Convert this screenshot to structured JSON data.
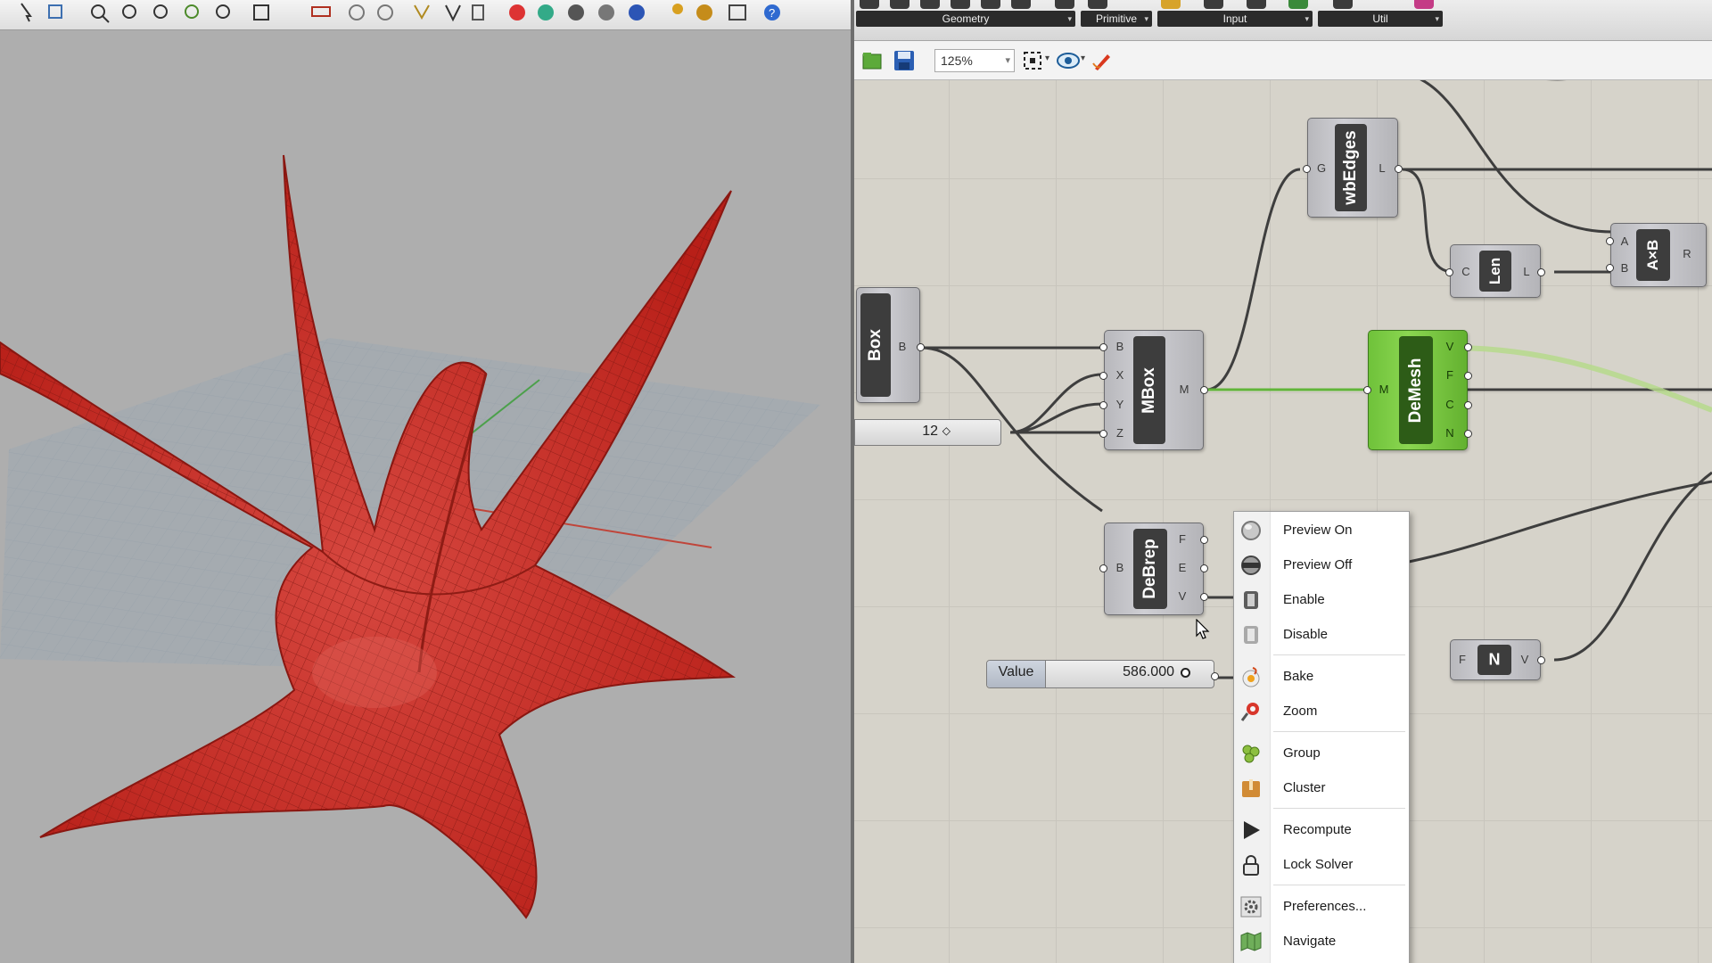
{
  "ribbon": {
    "tabs": [
      "Geometry",
      "Primitive",
      "Input",
      "Util"
    ]
  },
  "toolbar": {
    "zoom": "125%",
    "icons": [
      "open-file-icon",
      "save-icon",
      "zoom-extents-icon",
      "preview-eye-icon",
      "sketch-pen-icon"
    ]
  },
  "components": {
    "box": {
      "label": "Box",
      "outputs": [
        "B"
      ]
    },
    "mbox": {
      "label": "MBox",
      "inputs": [
        "B",
        "X",
        "Y",
        "Z"
      ],
      "outputs": [
        "M"
      ]
    },
    "wbedges": {
      "label": "wbEdges",
      "inputs": [
        "G"
      ],
      "outputs": [
        "L"
      ]
    },
    "len": {
      "label": "Len",
      "inputs": [
        "C"
      ],
      "outputs": [
        "L"
      ]
    },
    "axb": {
      "label": "A×B",
      "inputs": [
        "A",
        "B"
      ],
      "outputs": [
        "R"
      ]
    },
    "demesh": {
      "label": "DeMesh",
      "inputs": [
        "M"
      ],
      "outputs": [
        "V",
        "F",
        "C",
        "N"
      ]
    },
    "debrep": {
      "label": "DeBrep",
      "inputs": [
        "B"
      ],
      "outputs": [
        "F",
        "E",
        "V"
      ]
    },
    "n": {
      "label": "N",
      "inputs": [
        "F"
      ],
      "outputs": [
        "V"
      ]
    }
  },
  "int_slider": {
    "value": "12"
  },
  "number_slider": {
    "label": "Value",
    "value": "586.000"
  },
  "context_menu": {
    "items": [
      {
        "label": "Preview On",
        "icon": "preview-on-icon"
      },
      {
        "label": "Preview Off",
        "icon": "preview-off-icon"
      },
      {
        "label": "Enable",
        "icon": "enable-icon"
      },
      {
        "label": "Disable",
        "icon": "disable-icon"
      },
      {
        "label": "Bake",
        "icon": "bake-icon"
      },
      {
        "label": "Zoom",
        "icon": "zoom-icon"
      },
      {
        "label": "Group",
        "icon": "group-icon"
      },
      {
        "label": "Cluster",
        "icon": "cluster-icon"
      },
      {
        "label": "Recompute",
        "icon": "recompute-icon"
      },
      {
        "label": "Lock Solver",
        "icon": "lock-solver-icon"
      },
      {
        "label": "Preferences...",
        "icon": "preferences-icon"
      },
      {
        "label": "Navigate",
        "icon": "navigate-icon"
      }
    ]
  },
  "colors": {
    "mesh": "#c8241c",
    "selected_component": "#7ccc45",
    "canvas": "#d6d3ca"
  }
}
